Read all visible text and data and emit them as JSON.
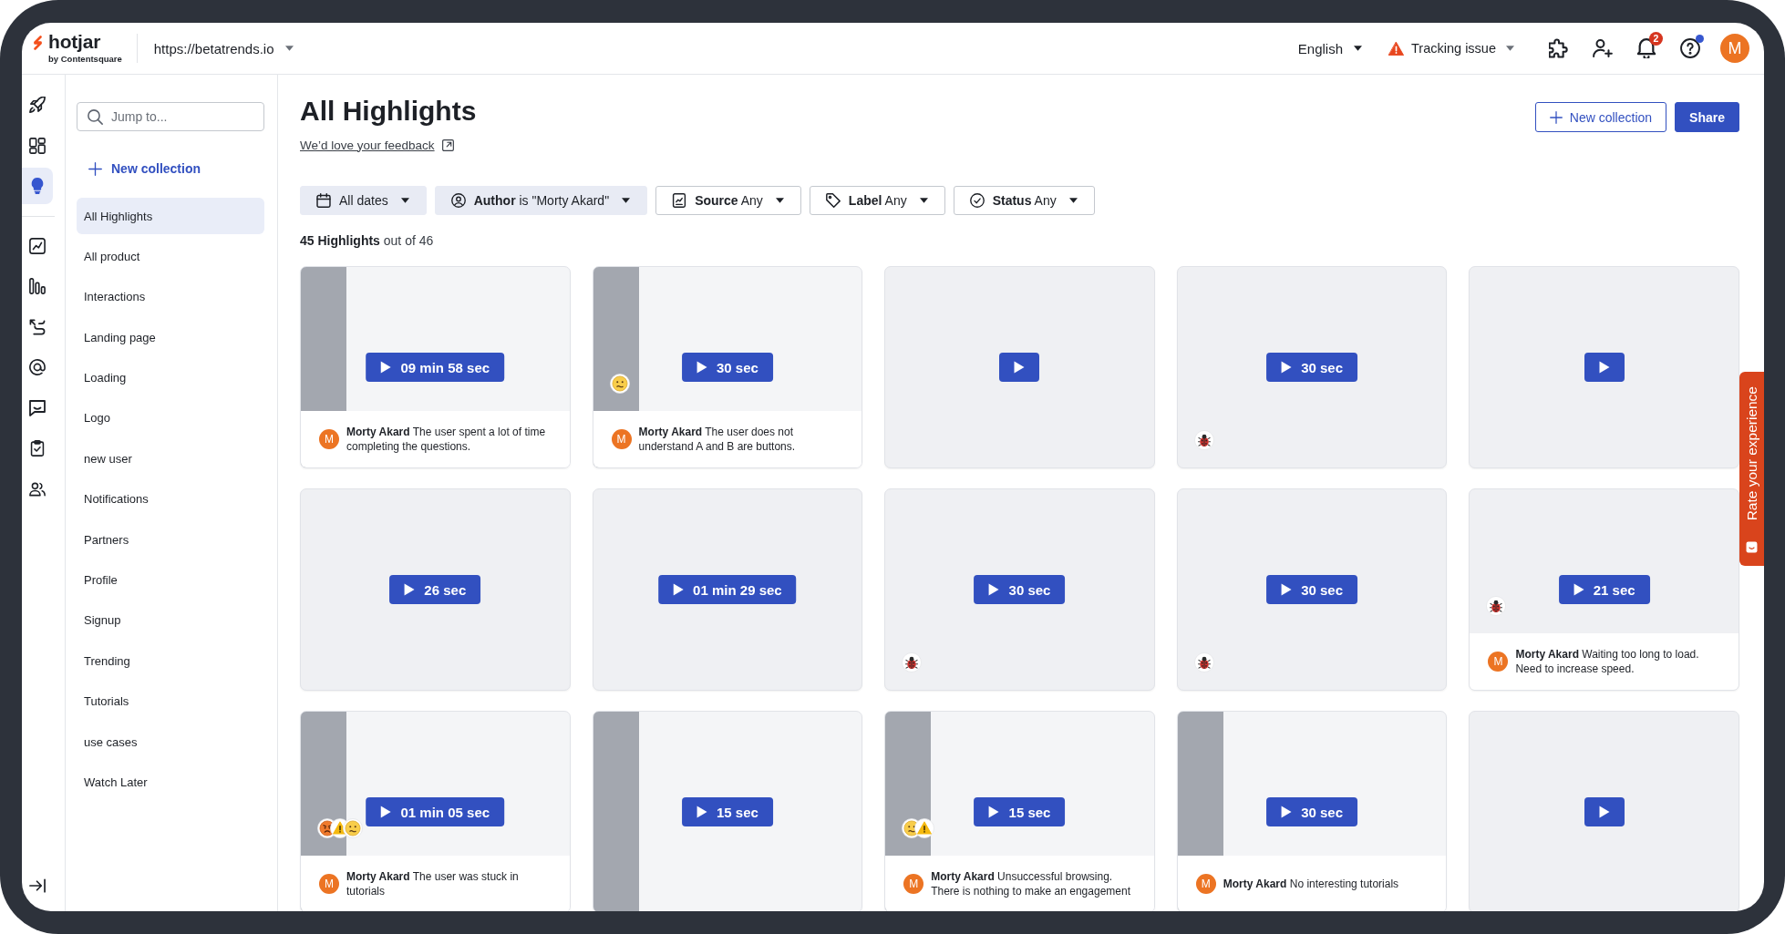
{
  "topbar": {
    "logo": {
      "wordmark": "hotjar",
      "byline": "by Contentsquare"
    },
    "site": "https://betatrends.io",
    "language": "English",
    "tracking": "Tracking issue",
    "notifications": "2",
    "help_unread": true,
    "avatar": "M"
  },
  "rail": {
    "sections": [
      [
        {
          "selected": false
        },
        {
          "selected": false
        },
        {
          "selected": true
        }
      ],
      [
        {
          "selected": false
        },
        {
          "selected": false
        },
        {
          "selected": false
        },
        {
          "selected": false
        },
        {
          "selected": false
        },
        {
          "selected": false
        },
        {
          "selected": false
        }
      ]
    ]
  },
  "sidebar": {
    "search": {
      "placeholder": "Jump to..."
    },
    "new_collection": "New collection",
    "collections": [
      {
        "label": "All Highlights",
        "selected": true
      },
      {
        "label": "All product",
        "selected": false
      },
      {
        "label": "Interactions",
        "selected": false
      },
      {
        "label": "Landing page",
        "selected": false
      },
      {
        "label": "Loading",
        "selected": false
      },
      {
        "label": "Logo",
        "selected": false
      },
      {
        "label": "new user",
        "selected": false
      },
      {
        "label": "Notifications",
        "selected": false
      },
      {
        "label": "Partners",
        "selected": false
      },
      {
        "label": "Profile",
        "selected": false
      },
      {
        "label": "Signup",
        "selected": false
      },
      {
        "label": "Trending",
        "selected": false
      },
      {
        "label": "Tutorials",
        "selected": false
      },
      {
        "label": "use cases",
        "selected": false
      },
      {
        "label": "Watch Later",
        "selected": false
      }
    ]
  },
  "header": {
    "title": "All Highlights",
    "feedback_link": "We’d love your feedback",
    "actions": [
      {
        "label": "New collection",
        "kind": "outline"
      },
      {
        "label": "Share",
        "kind": "primary"
      }
    ]
  },
  "filters": [
    {
      "text": "All dates",
      "active": true
    },
    {
      "text": "**Author** is \"Morty Akard\"",
      "active": true
    },
    {
      "text": "**Source** Any",
      "active": false
    },
    {
      "text": "**Label** Any",
      "active": false
    },
    {
      "text": "**Status** Any",
      "active": false
    }
  ],
  "summary": "**45 Highlights** out of 46",
  "highlights": [
    {
      "duration": "09 min 58 sec",
      "kind": "screen",
      "note": {
        "avatar": "M",
        "text": "**Morty Akard** The user spent a lot of time completing the questions."
      }
    },
    {
      "duration": "30 sec",
      "kind": "screen",
      "markers": [
        {
          "kind": "confused"
        }
      ],
      "note": {
        "avatar": "M",
        "text": "**Morty Akard** The user does not understand A and B are buttons."
      }
    },
    {
      "kind": "blank"
    },
    {
      "duration": "30 sec",
      "kind": "blank",
      "markers": [
        {
          "kind": "bug"
        }
      ]
    },
    {
      "kind": "blank"
    },
    {
      "duration": "26 sec",
      "kind": "blank"
    },
    {
      "duration": "01 min 29 sec",
      "kind": "blank"
    },
    {
      "duration": "30 sec",
      "kind": "blank",
      "markers": [
        {
          "kind": "bug"
        }
      ]
    },
    {
      "duration": "30 sec",
      "kind": "blank",
      "markers": [
        {
          "kind": "bug"
        }
      ]
    },
    {
      "duration": "21 sec",
      "kind": "blank",
      "markers": [
        {
          "kind": "bug"
        }
      ],
      "note": {
        "avatar": "M",
        "text": "**Morty Akard** Waiting too long to load. Need to increase speed."
      }
    },
    {
      "duration": "01 min 05 sec",
      "kind": "screen",
      "markers": [
        {
          "kind": "angry"
        },
        {
          "kind": "warning"
        },
        {
          "kind": "confused"
        }
      ],
      "note": {
        "avatar": "M",
        "text": "**Morty Akard** The user was stuck in tutorials"
      }
    },
    {
      "duration": "15 sec",
      "kind": "screen"
    },
    {
      "duration": "15 sec",
      "kind": "screen",
      "markers": [
        {
          "kind": "confused"
        },
        {
          "kind": "warning"
        }
      ],
      "note": {
        "avatar": "M",
        "text": "**Morty Akard** Unsuccessful browsing. There is nothing to make an engagement"
      }
    },
    {
      "duration": "30 sec",
      "kind": "screen",
      "note": {
        "avatar": "M",
        "text": "**Morty Akard** No interesting tutorials"
      }
    },
    {
      "kind": "blank"
    }
  ],
  "feedback_tab": {
    "label": "Rate your experience"
  }
}
